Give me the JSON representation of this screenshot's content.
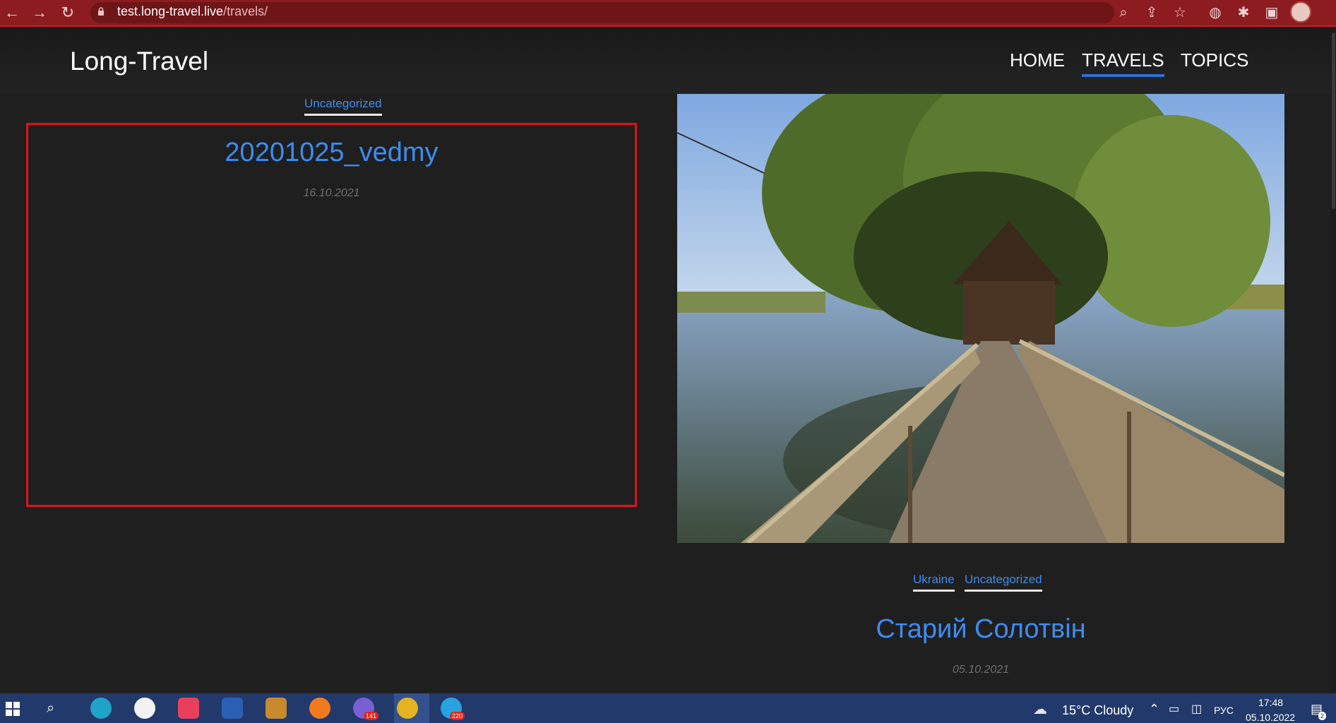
{
  "browser": {
    "url_host": "test.long-travel.live",
    "url_path": "/travels/"
  },
  "site": {
    "logo": "Long-Travel",
    "nav": [
      {
        "label": "HOME",
        "active": false
      },
      {
        "label": "TRAVELS",
        "active": true
      },
      {
        "label": "TOPICS",
        "active": false
      }
    ]
  },
  "posts": [
    {
      "categories": [
        "Uncategorized"
      ],
      "title": "20201025_vedmy",
      "date": "16.10.2021"
    },
    {
      "categories": [
        "Ukraine",
        "Uncategorized"
      ],
      "title": "Старий Солотвін",
      "date": "05.10.2021",
      "image_icon": "lake-bridge-photo"
    }
  ],
  "taskbar": {
    "weather": "15°C  Cloudy",
    "language": "РУС",
    "time": "17:48",
    "date": "05.10.2022",
    "viber_badge": "141",
    "telegram_badge": "220",
    "notifications_badge": "2"
  },
  "colors": {
    "browser_bar": "#8c1c1f",
    "link_blue": "#3d8cf0",
    "highlight_red": "#e0121a",
    "taskbar": "#22396b"
  }
}
